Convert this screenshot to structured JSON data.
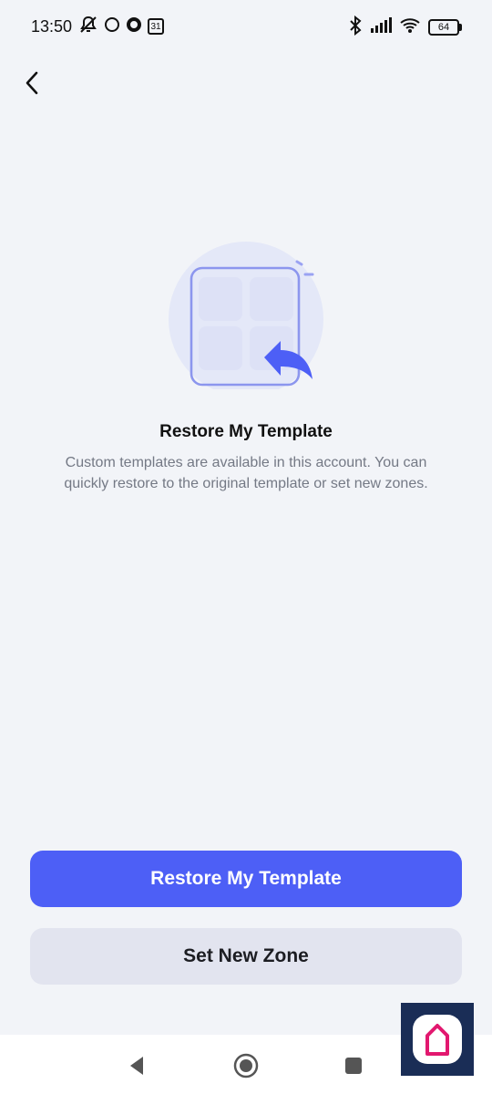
{
  "status_bar": {
    "time": "13:50",
    "calendar_day": "31",
    "battery": "64"
  },
  "header": {
    "back_icon": "chevron-left-icon"
  },
  "content": {
    "title": "Restore My Template",
    "description": "Custom templates are available in this account. You can quickly restore to the original template or set new zones."
  },
  "actions": {
    "primary_label": "Restore My Template",
    "secondary_label": "Set New Zone"
  },
  "colors": {
    "accent": "#4d5ff6",
    "background": "#f2f4f8",
    "secondary_button": "#e2e4ef"
  },
  "navigation": {
    "back": "triangle-back-icon",
    "home": "circle-home-icon",
    "recents": "square-recents-icon"
  }
}
